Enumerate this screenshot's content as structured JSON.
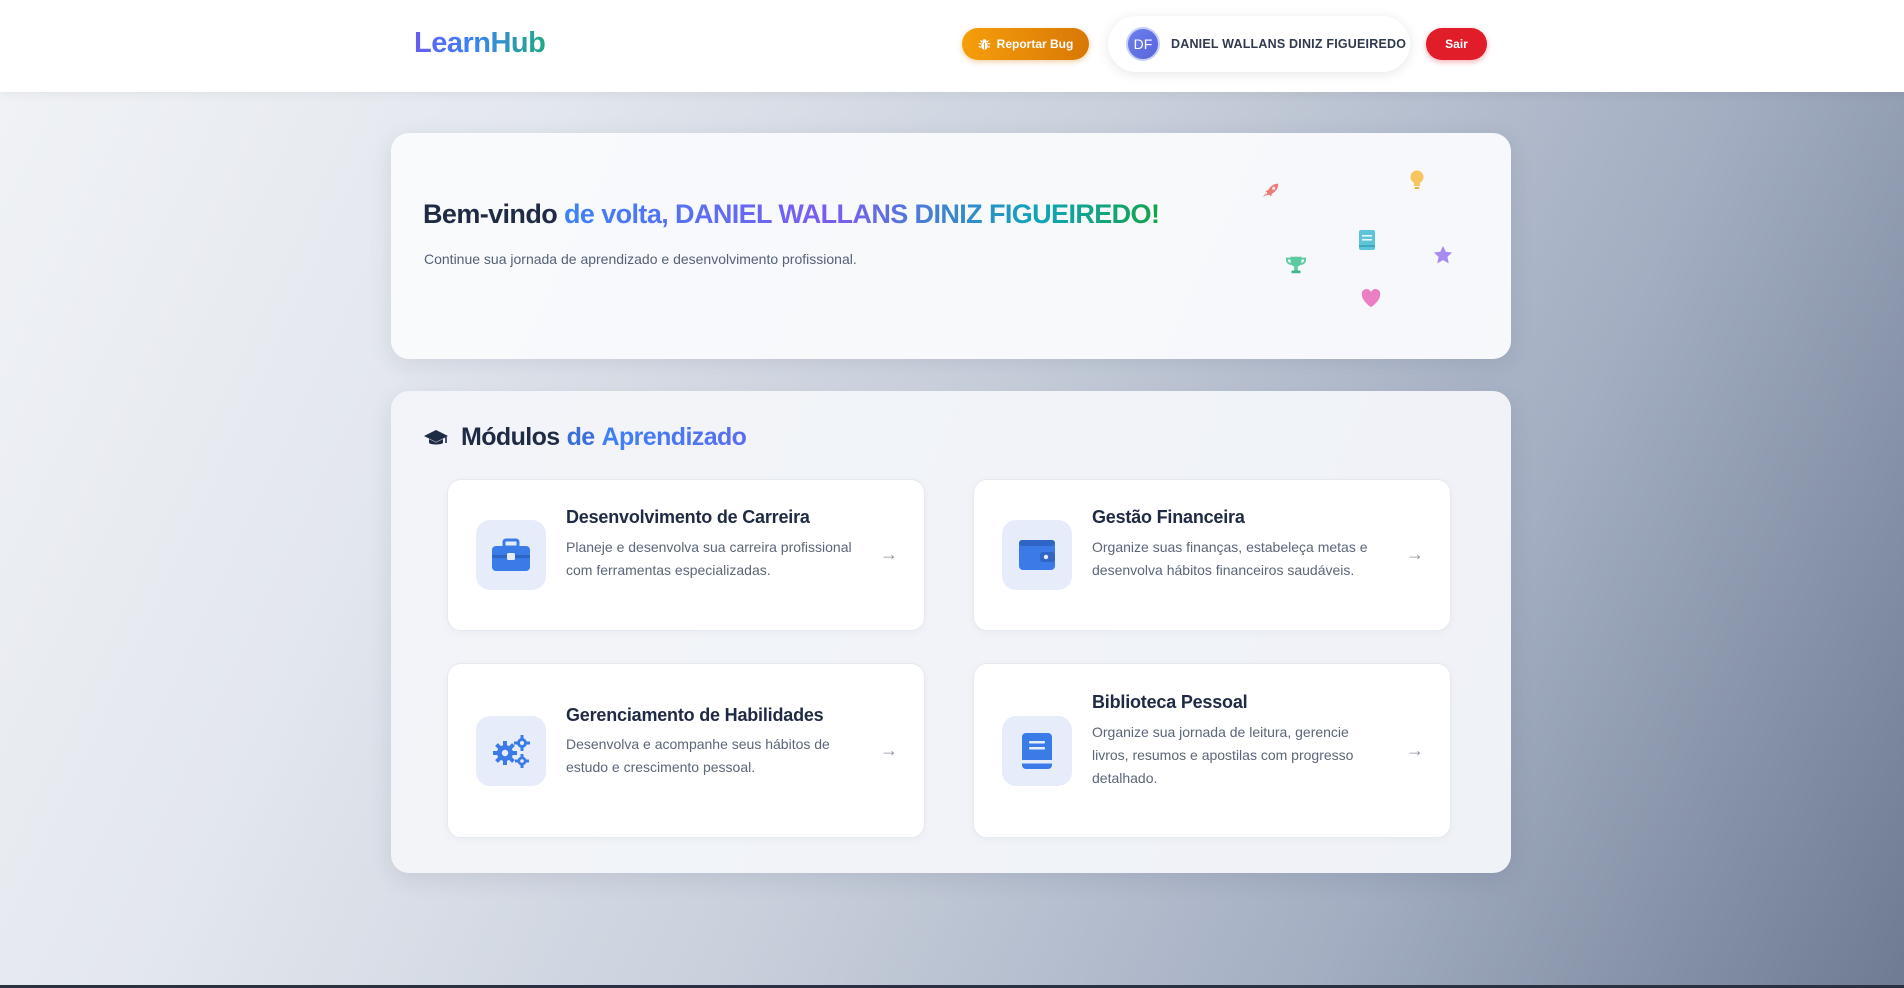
{
  "header": {
    "logo": "LearnHub",
    "report_bug_label": "Reportar Bug",
    "user": {
      "initials": "DF",
      "name": "DANIEL WALLANS DINIZ FIGUEIREDO"
    },
    "logout_label": "Sair"
  },
  "welcome": {
    "title_prefix": "Bem-vindo",
    "title_highlight": "de volta, DANIEL WALLANS DINIZ FIGUEIREDO!",
    "subtitle": "Continue sua jornada de aprendizado e desenvolvimento profissional.",
    "decor_icons": [
      "rocket-icon",
      "lightbulb-icon",
      "book-icon",
      "trophy-icon",
      "star-icon",
      "heart-icon"
    ]
  },
  "modules": {
    "title_part1": "Módulos",
    "title_part2": "de",
    "title_part3": "Aprendizado",
    "items": [
      {
        "title": "Desenvolvimento de Carreira",
        "description": "Planeje e desenvolva sua carreira profissional com ferramentas especializadas.",
        "icon": "briefcase-icon",
        "arrow": "→"
      },
      {
        "title": "Gestão Financeira",
        "description": "Organize suas finanças, estabeleça metas e desenvolva hábitos financeiros saudáveis.",
        "icon": "wallet-icon",
        "arrow": "→"
      },
      {
        "title": "Gerenciamento de Habilidades",
        "description": "Desenvolva e acompanhe seus hábitos de estudo e crescimento pessoal.",
        "icon": "gears-icon",
        "arrow": "→"
      },
      {
        "title": "Biblioteca Pessoal",
        "description": "Organize sua jornada de leitura, gerencie livros, resumos e apostilas com progresso detalhado.",
        "icon": "book-icon",
        "arrow": "→"
      }
    ]
  },
  "colors": {
    "accent_blue": "#3b82f6",
    "bug_button": "#f59e0b",
    "logout_button": "#e11d2a"
  }
}
